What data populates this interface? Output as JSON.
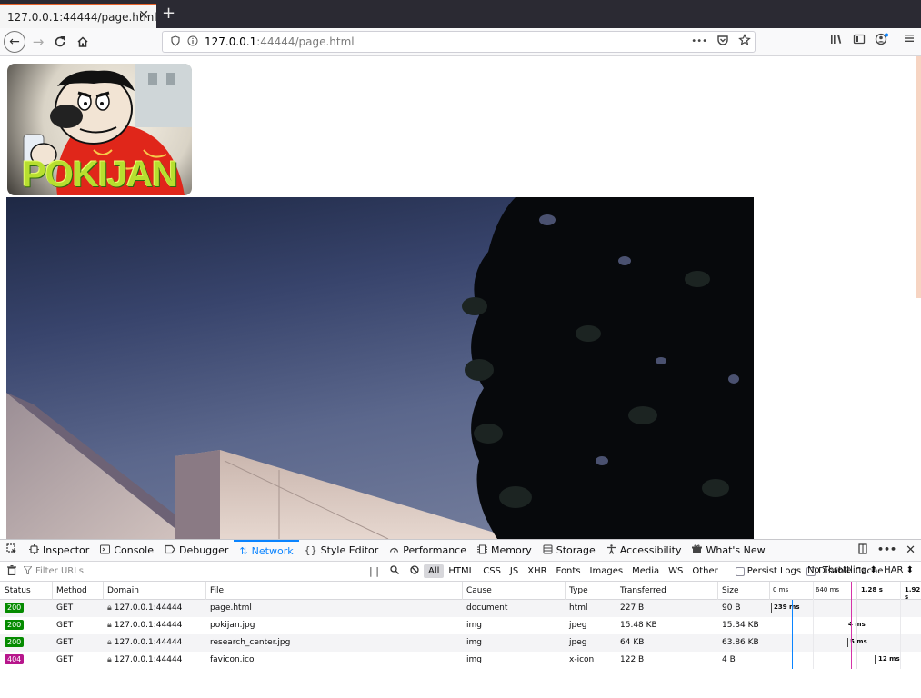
{
  "browser": {
    "tab_title": "127.0.0.1:44444/page.html",
    "tab_close": "✕",
    "new_tab": "+",
    "url_host": "127.0.0.1",
    "url_rest": ":44444/page.html",
    "more_icon": "•••"
  },
  "page": {
    "logo_text": "POKIJAN"
  },
  "devtools": {
    "tabs": [
      {
        "label": "Inspector",
        "icon": "inspector-icon"
      },
      {
        "label": "Console",
        "icon": "console-icon"
      },
      {
        "label": "Debugger",
        "icon": "debugger-icon"
      },
      {
        "label": "Network",
        "icon": "network-icon",
        "active": true
      },
      {
        "label": "Style Editor",
        "icon": "style-editor-icon"
      },
      {
        "label": "Performance",
        "icon": "performance-icon"
      },
      {
        "label": "Memory",
        "icon": "memory-icon"
      },
      {
        "label": "Storage",
        "icon": "storage-icon"
      },
      {
        "label": "Accessibility",
        "icon": "accessibility-icon"
      },
      {
        "label": "What's New",
        "icon": "whats-new-icon"
      }
    ],
    "filter_placeholder": "Filter URLs",
    "filter_types": [
      "All",
      "HTML",
      "CSS",
      "JS",
      "XHR",
      "Fonts",
      "Images",
      "Media",
      "WS",
      "Other"
    ],
    "active_filter": "All",
    "persist_logs": "Persist Logs",
    "disable_cache": "Disable Cache",
    "throttling": "No Throttling ⬍",
    "har": "HAR ⬍",
    "columns": [
      "Status",
      "Method",
      "Domain",
      "File",
      "Cause",
      "Type",
      "Transferred",
      "Size"
    ],
    "timeline_ticks": [
      "0 ms",
      "640 ms",
      "1.28 s",
      "1.92 s"
    ],
    "requests": [
      {
        "status": "200",
        "method": "GET",
        "domain": "127.0.0.1:44444",
        "file": "page.html",
        "cause": "document",
        "type": "html",
        "transferred": "227 B",
        "size": "90 B",
        "timing": "239 ms"
      },
      {
        "status": "200",
        "method": "GET",
        "domain": "127.0.0.1:44444",
        "file": "pokijan.jpg",
        "cause": "img",
        "type": "jpeg",
        "transferred": "15.48 KB",
        "size": "15.34 KB",
        "timing": "4 ms"
      },
      {
        "status": "200",
        "method": "GET",
        "domain": "127.0.0.1:44444",
        "file": "research_center.jpg",
        "cause": "img",
        "type": "jpeg",
        "transferred": "64 KB",
        "size": "63.86 KB",
        "timing": "5 ms"
      },
      {
        "status": "404",
        "method": "GET",
        "domain": "127.0.0.1:44444",
        "file": "favicon.ico",
        "cause": "img",
        "type": "x-icon",
        "transferred": "122 B",
        "size": "4 B",
        "timing": "12 ms"
      }
    ]
  },
  "colors": {
    "accent": "#0a84ff",
    "status_ok": "#058b00",
    "status_not_found": "#b7168c",
    "tab_highlight": "#e8632a"
  }
}
